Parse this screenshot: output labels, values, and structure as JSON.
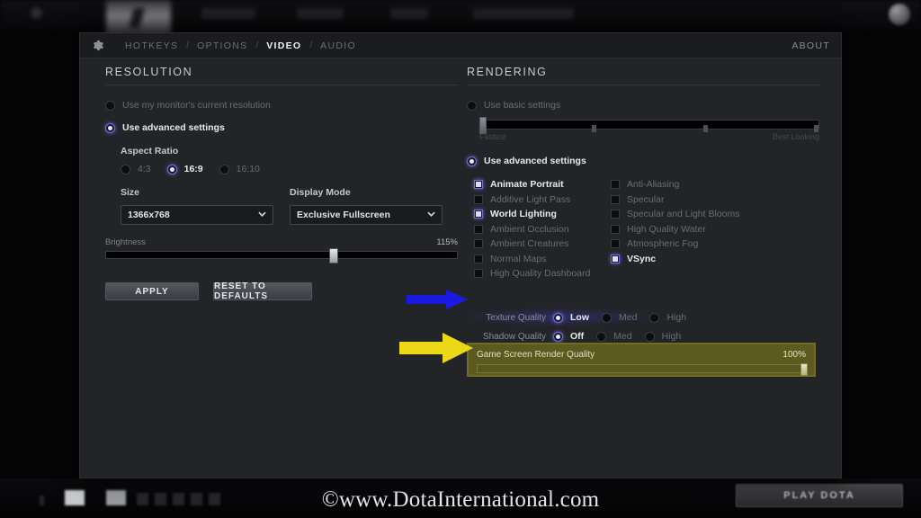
{
  "watermark": "©www.DotaInternational.com",
  "bottom": {
    "play_button": "PLAY DOTA"
  },
  "colors": {
    "panel_bg": "#232427",
    "accent_blue": "#7070d8",
    "arrow_blue": "#1a1ae0",
    "arrow_yellow": "#ecd816",
    "highlight_olive": "#5c5a1e"
  },
  "tabs": {
    "gear_icon": "gear-icon",
    "items": [
      {
        "label": "HOTKEYS",
        "active": false
      },
      {
        "label": "OPTIONS",
        "active": false
      },
      {
        "label": "VIDEO",
        "active": true
      },
      {
        "label": "AUDIO",
        "active": false
      }
    ],
    "separator": "/",
    "about": "ABOUT"
  },
  "resolution": {
    "title": "RESOLUTION",
    "mode_options": [
      {
        "label": "Use my monitor's current resolution",
        "selected": false
      },
      {
        "label": "Use advanced settings",
        "selected": true
      }
    ],
    "aspect_ratio": {
      "label": "Aspect Ratio",
      "options": [
        {
          "label": "4:3",
          "selected": false
        },
        {
          "label": "16:9",
          "selected": true
        },
        {
          "label": "16:10",
          "selected": false
        }
      ]
    },
    "size": {
      "label": "Size",
      "value": "1366x768"
    },
    "display_mode": {
      "label": "Display Mode",
      "value": "Exclusive Fullscreen"
    },
    "brightness": {
      "label": "Brightness",
      "value": "115%",
      "percent": 65
    },
    "apply_button": "APPLY",
    "reset_button": "RESET TO DEFAULTS"
  },
  "rendering": {
    "title": "RENDERING",
    "basic": {
      "label": "Use basic settings",
      "selected": false,
      "slider_min_label": "Fastest",
      "slider_max_label": "Best Looking",
      "slider_percent": 0
    },
    "advanced": {
      "label": "Use advanced settings",
      "selected": true
    },
    "checkboxes_left": [
      {
        "label": "Animate Portrait",
        "checked": true
      },
      {
        "label": "Additive Light Pass",
        "checked": false
      },
      {
        "label": "World Lighting",
        "checked": true
      },
      {
        "label": "Ambient Occlusion",
        "checked": false
      },
      {
        "label": "Ambient Creatures",
        "checked": false
      },
      {
        "label": "Normal Maps",
        "checked": false
      },
      {
        "label": "High Quality Dashboard",
        "checked": false
      }
    ],
    "checkboxes_right": [
      {
        "label": "Anti-Aliasing",
        "checked": false
      },
      {
        "label": "Specular",
        "checked": false
      },
      {
        "label": "Specular and Light Blooms",
        "checked": false
      },
      {
        "label": "High Quality Water",
        "checked": false
      },
      {
        "label": "Atmospheric Fog",
        "checked": false
      },
      {
        "label": "VSync",
        "checked": true
      }
    ],
    "texture_quality": {
      "label": "Texture Quality",
      "options": [
        {
          "label": "Low",
          "selected": true
        },
        {
          "label": "Med",
          "selected": false
        },
        {
          "label": "High",
          "selected": false
        }
      ]
    },
    "shadow_quality": {
      "label": "Shadow Quality",
      "options": [
        {
          "label": "Off",
          "selected": true
        },
        {
          "label": "Med",
          "selected": false
        },
        {
          "label": "High",
          "selected": false
        }
      ]
    },
    "render_quality": {
      "label": "Game Screen Render Quality",
      "value": "100%",
      "percent": 100
    }
  },
  "annotations": {
    "blue_arrow": "blue-arrow-pointing-to-texture-quality",
    "yellow_arrow": "yellow-arrow-pointing-to-render-quality"
  }
}
